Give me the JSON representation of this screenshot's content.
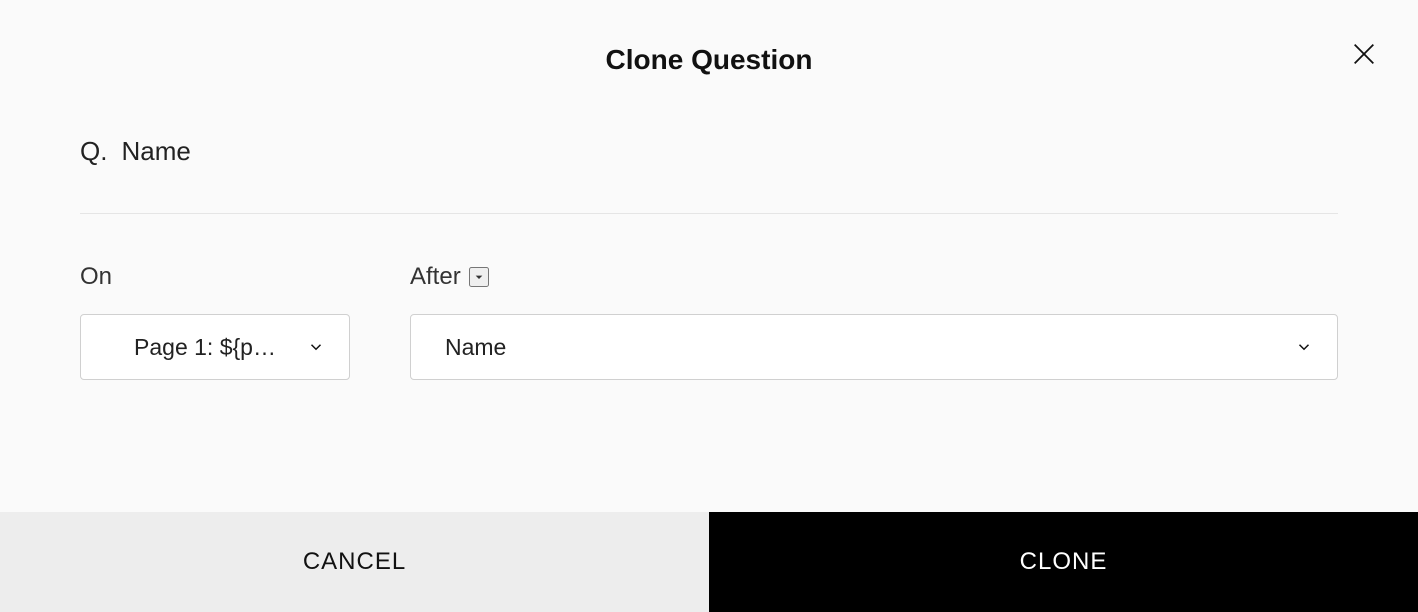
{
  "dialog": {
    "title": "Clone Question",
    "question_prefix": "Q.",
    "question_name": "Name"
  },
  "controls": {
    "on": {
      "label": "On",
      "selected": "Page 1: ${p…"
    },
    "after": {
      "label": "After",
      "selected": "Name"
    }
  },
  "footer": {
    "cancel": "CANCEL",
    "clone": "CLONE"
  }
}
